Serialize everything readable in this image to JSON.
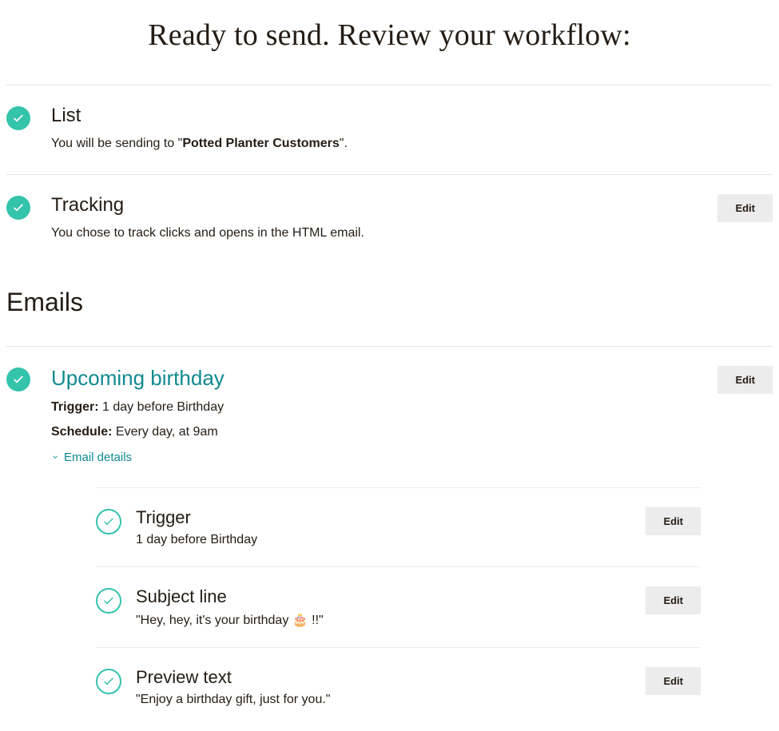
{
  "page_title": "Ready to send. Review your workflow:",
  "sections": {
    "list": {
      "label": "List",
      "desc_prefix": "You will be sending to \"",
      "list_name": "Potted Planter Customers",
      "desc_suffix": "\"."
    },
    "tracking": {
      "label": "Tracking",
      "desc": "You chose to track clicks and opens in the HTML email.",
      "edit": "Edit"
    }
  },
  "emails_heading": "Emails",
  "email": {
    "title": "Upcoming birthday",
    "trigger_label": "Trigger:",
    "trigger_value": " 1 day before Birthday",
    "schedule_label": "Schedule:",
    "schedule_value": " Every day, at 9am",
    "details_toggle": "Email details",
    "edit": "Edit",
    "sub": {
      "trigger": {
        "label": "Trigger",
        "desc": "1 day before Birthday",
        "edit": "Edit"
      },
      "subject": {
        "label": "Subject line",
        "desc": "\"Hey, hey, it's your birthday 🎂 !!\"",
        "edit": "Edit"
      },
      "preview": {
        "label": "Preview text",
        "desc": "\"Enjoy a birthday gift, just for you.\"",
        "edit": "Edit"
      }
    }
  }
}
